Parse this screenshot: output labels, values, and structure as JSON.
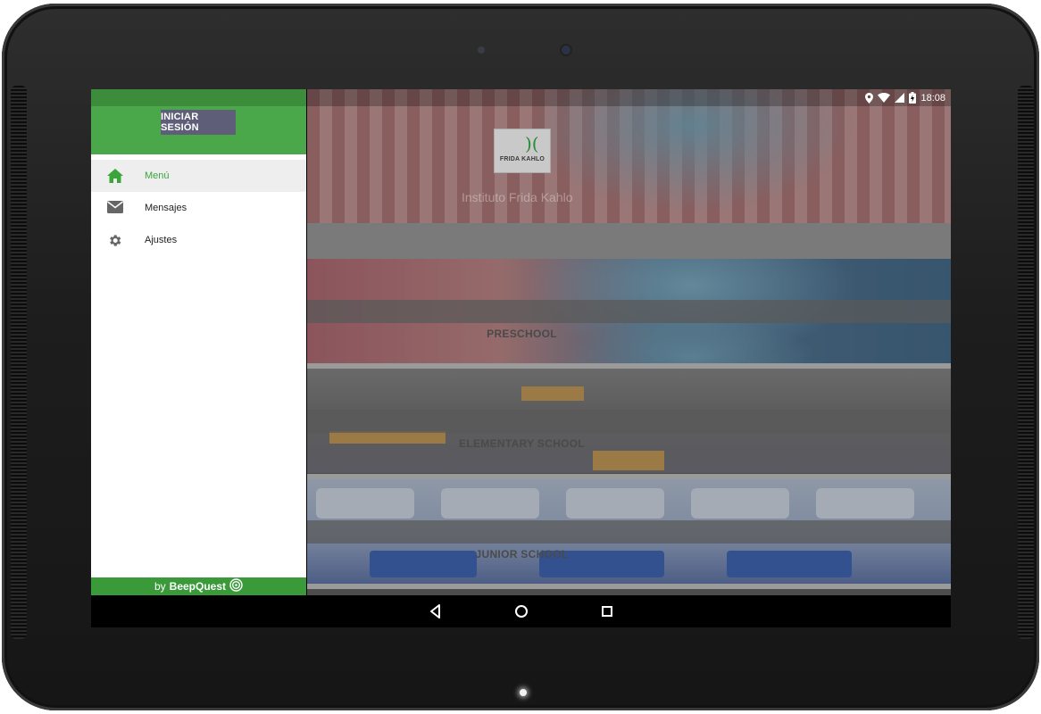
{
  "status_bar": {
    "time": "18:08"
  },
  "drawer": {
    "login_label": "INICIAR SESIÓN",
    "items": [
      {
        "label": "Menú",
        "icon": "home-icon",
        "active": true
      },
      {
        "label": "Mensajes",
        "icon": "envelope-icon",
        "active": false
      },
      {
        "label": "Ajustes",
        "icon": "gear-icon",
        "active": false
      }
    ],
    "footer": {
      "prefix": "by",
      "brand": "BeepQuest",
      "icon": "beepquest-logo-icon"
    }
  },
  "header": {
    "logo_text": "FRIDA KAHLO",
    "institute_name": "Instituto Frida Kahlo"
  },
  "categories": [
    {
      "label": "PRESCHOOL"
    },
    {
      "label": "ELEMENTARY SCHOOL"
    },
    {
      "label": "JUNIOR SCHOOL"
    }
  ],
  "navigation_bar": {
    "buttons": [
      "back-icon",
      "home-circle-icon",
      "recents-icon"
    ]
  },
  "colors": {
    "accent_green": "#4aa74a",
    "login_button": "#5e5e78",
    "active_item_text": "#3aa63a"
  }
}
